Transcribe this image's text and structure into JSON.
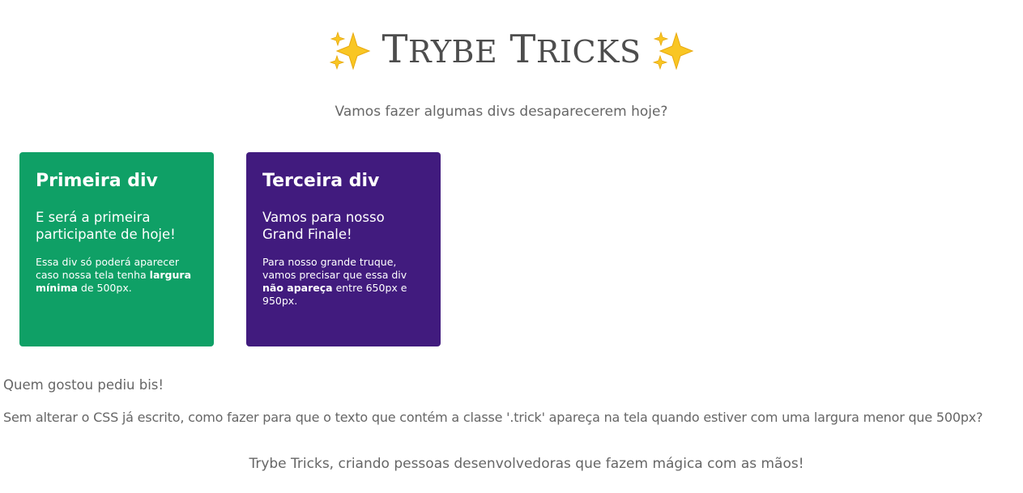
{
  "header": {
    "title_first_letter_1": "T",
    "title_rest_1": "RYBE",
    "title_first_letter_2": "T",
    "title_rest_2": "RICKS",
    "left_icon": "sparkles-icon",
    "right_icon": "sparkles-icon"
  },
  "subtitle": "Vamos fazer algumas divs desaparecerem hoje?",
  "cards": [
    {
      "title": "Primeira div",
      "lead": "E será a primeira participante de hoje!",
      "text_before": "Essa div só poderá aparecer caso nossa tela tenha ",
      "text_bold": "largura mínima",
      "text_after": " de 500px.",
      "color": "#0fa066"
    },
    {
      "title": "Terceira div",
      "lead": "Vamos para nosso Grand Finale!",
      "text_before": "Para nosso grande truque, vamos precisar que essa div ",
      "text_bold": "não apareça",
      "text_after": " entre 650px e 950px.",
      "color": "#411b7e"
    }
  ],
  "bis": "Quem gostou pediu bis!",
  "question": "Sem alterar o CSS já escrito, como fazer para que o texto que contém a classe '.trick' apareça na tela quando estiver com uma largura menor que 500px?",
  "footer": "Trybe Tricks, criando pessoas desenvolvedoras que fazem mágica com as mãos!"
}
